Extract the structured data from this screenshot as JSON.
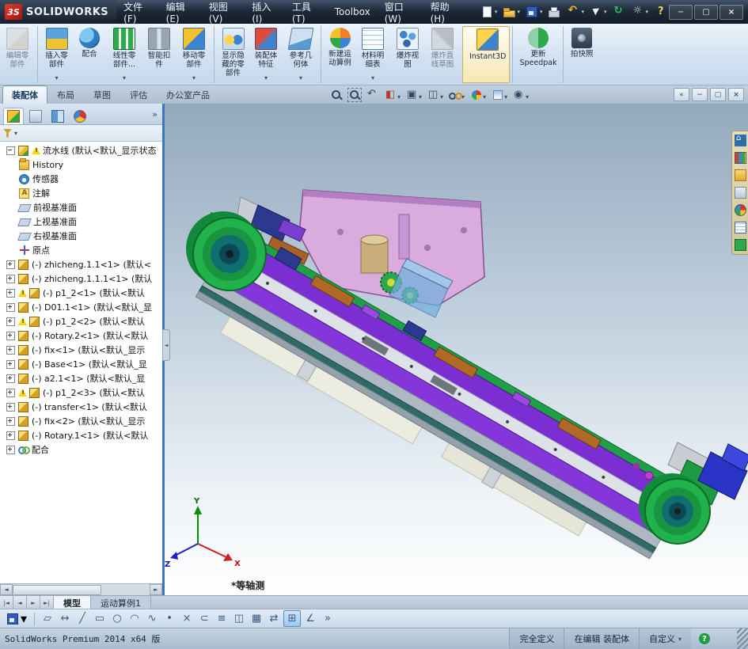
{
  "titlebar": {
    "logo_mark": "3S",
    "logo_text": "SOLIDWORKS",
    "menus": [
      "文件(F)",
      "编辑(E)",
      "视图(V)",
      "插入(I)",
      "工具(T)",
      "Toolbox",
      "窗口(W)",
      "帮助(H)"
    ],
    "quick": [
      {
        "icon": "new-doc",
        "dd": true
      },
      {
        "icon": "open",
        "dd": true
      },
      {
        "icon": "save",
        "dd": true
      },
      {
        "icon": "print",
        "dd": false
      },
      {
        "icon": "undo",
        "dd": true
      },
      {
        "icon": "select",
        "dd": true
      },
      {
        "icon": "rebuild",
        "dd": false
      },
      {
        "icon": "options",
        "dd": true
      },
      {
        "icon": "help",
        "dd": false
      }
    ],
    "window_buttons": [
      {
        "icon": "minimize"
      },
      {
        "icon": "restore"
      },
      {
        "icon": "close"
      }
    ]
  },
  "ribbon": {
    "buttons": [
      {
        "icon": "edit-component",
        "label": "编辑零\n部件",
        "disabled": true
      },
      {
        "icon": "insert-component",
        "label": "插入零\n部件",
        "dd": true,
        "sep": true
      },
      {
        "icon": "mate",
        "label": "配合"
      },
      {
        "icon": "linear-pattern",
        "label": "线性零\n部件...",
        "dd": true
      },
      {
        "icon": "smart-fasteners",
        "label": "智能扣\n件"
      },
      {
        "icon": "move-component",
        "label": "移动零\n部件",
        "dd": true
      },
      {
        "icon": "show-hidden",
        "label": "显示隐\n藏的零\n部件",
        "sep": true
      },
      {
        "icon": "assembly-features",
        "label": "装配体\n特征",
        "dd": true
      },
      {
        "icon": "reference-geometry",
        "label": "参考几\n何体",
        "dd": true
      },
      {
        "icon": "motion-study",
        "label": "新建运\n动算例",
        "sep": true
      },
      {
        "icon": "bom",
        "label": "材料明\n细表",
        "dd": true
      },
      {
        "icon": "exploded-view",
        "label": "爆炸视\n图"
      },
      {
        "icon": "explode-line",
        "label": "爆炸直\n线草图",
        "disabled": true
      },
      {
        "icon": "instant3d",
        "label": "Instant3D",
        "active": true,
        "sep": true
      },
      {
        "icon": "speedpak",
        "label": "更新\nSpeedpak",
        "sep": true
      },
      {
        "icon": "snapshot",
        "label": "拍快照",
        "sep": true
      }
    ]
  },
  "tabrow": {
    "tabs": [
      {
        "label": "装配体",
        "active": true
      },
      {
        "label": "布局"
      },
      {
        "label": "草图"
      },
      {
        "label": "评估"
      },
      {
        "label": "办公室产品"
      }
    ],
    "headsup": [
      {
        "icon": "zoom-fit"
      },
      {
        "icon": "zoom-area"
      },
      {
        "icon": "previous-view"
      },
      {
        "icon": "section-view",
        "dd": true
      },
      {
        "icon": "view-orientation",
        "dd": true
      },
      {
        "icon": "display-style",
        "dd": true
      },
      {
        "icon": "hide-show",
        "dd": true
      },
      {
        "icon": "edit-appearance",
        "dd": true
      },
      {
        "icon": "apply-scene",
        "dd": true
      },
      {
        "icon": "view-settings",
        "dd": true
      }
    ],
    "doc_buttons": [
      {
        "icon": "collapse"
      },
      {
        "icon": "minimize-doc"
      },
      {
        "icon": "restore-doc"
      },
      {
        "icon": "close-doc"
      }
    ]
  },
  "panel": {
    "tabs": [
      {
        "icon": "featuremanager",
        "active": true
      },
      {
        "icon": "propertymanager"
      },
      {
        "icon": "configurationmanager"
      },
      {
        "icon": "displaymanager"
      }
    ]
  },
  "tree": {
    "root": "流水线 (默认<默认_显示状态",
    "items": [
      {
        "icon": "folder",
        "label": "History"
      },
      {
        "icon": "sensors",
        "label": "传感器"
      },
      {
        "icon": "anno",
        "label": "注解"
      },
      {
        "icon": "plane",
        "label": "前视基准面"
      },
      {
        "icon": "plane",
        "label": "上视基准面"
      },
      {
        "icon": "plane",
        "label": "右视基准面"
      },
      {
        "icon": "origin",
        "label": "原点"
      },
      {
        "icon": "part",
        "label": "(-) zhicheng.1.1<1> (默认<",
        "exp": true
      },
      {
        "icon": "part",
        "label": "(-) zhicheng.1.1.1<1> (默认",
        "exp": true
      },
      {
        "icon": "part",
        "label": "(-) p1_2<1> (默认<默认",
        "exp": true,
        "warn": true
      },
      {
        "icon": "part",
        "label": "(-) D01.1<1> (默认<默认_显",
        "exp": true
      },
      {
        "icon": "part",
        "label": "(-) p1_2<2> (默认<默认",
        "exp": true,
        "warn": true
      },
      {
        "icon": "part",
        "label": "(-) Rotary.2<1> (默认<默认",
        "exp": true
      },
      {
        "icon": "part",
        "label": "(-) fix<1> (默认<默认_显示",
        "exp": true
      },
      {
        "icon": "part",
        "label": "(-) Base<1> (默认<默认_显",
        "exp": true
      },
      {
        "icon": "part",
        "label": "(-) a2.1<1> (默认<默认_显",
        "exp": true
      },
      {
        "icon": "part",
        "label": "(-) p1_2<3> (默认<默认",
        "exp": true,
        "warn": true
      },
      {
        "icon": "part",
        "label": "(-) transfer<1> (默认<默认",
        "exp": true
      },
      {
        "icon": "part",
        "label": "(-) fix<2> (默认<默认_显示",
        "exp": true
      },
      {
        "icon": "part",
        "label": "(-) Rotary.1<1> (默认<默认",
        "exp": true
      },
      {
        "icon": "mates",
        "label": "配合",
        "exp": true
      }
    ]
  },
  "viewport": {
    "view_label": "*等轴测",
    "triad": {
      "x": "X",
      "y": "Y",
      "z": "Z"
    }
  },
  "taskpane": {
    "items": [
      {
        "icon": "resources"
      },
      {
        "icon": "design-library"
      },
      {
        "icon": "file-explorer"
      },
      {
        "icon": "view-palette"
      },
      {
        "icon": "appearances"
      },
      {
        "icon": "custom-properties"
      },
      {
        "icon": "forum"
      }
    ]
  },
  "bottom": {
    "nav": [
      {
        "icon": "first"
      },
      {
        "icon": "prev"
      },
      {
        "icon": "next"
      },
      {
        "icon": "last"
      }
    ],
    "tabs": [
      {
        "label": "模型",
        "active": true
      },
      {
        "label": "运动算例1"
      }
    ]
  },
  "sketchbar": {
    "icons": [
      {
        "name": "sketch",
        "glyph": "▱"
      },
      {
        "name": "smart-dimension",
        "glyph": "↔"
      },
      {
        "name": "line",
        "glyph": "╱"
      },
      {
        "name": "rectangle",
        "glyph": "▭"
      },
      {
        "name": "circle",
        "glyph": "○"
      },
      {
        "name": "arc",
        "glyph": "◠"
      },
      {
        "name": "spline",
        "glyph": "∿"
      },
      {
        "name": "point",
        "glyph": "•"
      },
      {
        "name": "trim",
        "glyph": "×"
      },
      {
        "name": "convert-entities",
        "glyph": "⊂"
      },
      {
        "name": "offset",
        "glyph": "≡"
      },
      {
        "name": "mirror",
        "glyph": "◫"
      },
      {
        "name": "pattern",
        "glyph": "▦"
      },
      {
        "name": "move-entities",
        "glyph": "⇄"
      },
      {
        "name": "grid",
        "glyph": "⊞",
        "active": true
      },
      {
        "name": "angle-snap",
        "glyph": "∠"
      },
      {
        "name": "more",
        "glyph": "»"
      }
    ]
  },
  "statusbar": {
    "left": "SolidWorks Premium 2014 x64 版",
    "fully_defined": "完全定义",
    "editing": "在编辑 装配体",
    "custom": "自定义"
  },
  "colors": {
    "accent_blue": "#3f76b8",
    "rail_purple": "#7b2fd2",
    "pulley_green": "#22b24c",
    "plate_pink": "#d9abdf",
    "warning_yellow": "#ffd800"
  }
}
